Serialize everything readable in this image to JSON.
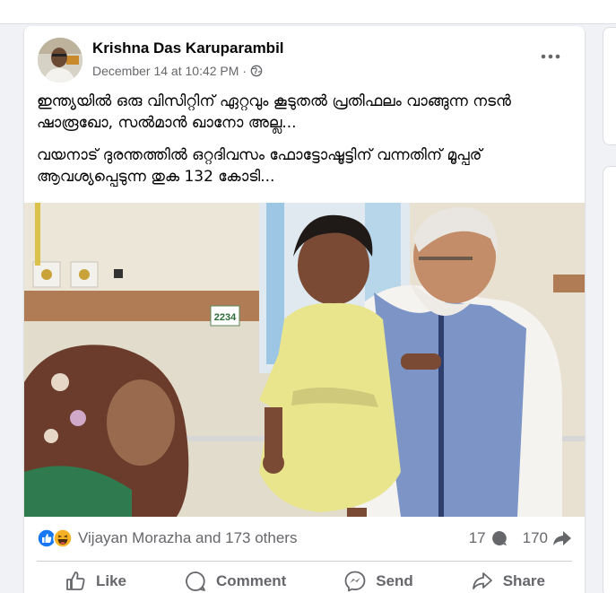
{
  "post": {
    "author": "Krishna Das Karuparambil",
    "timestamp": "December 14 at 10:42 PM",
    "separator": "·",
    "privacy_icon": "globe-icon",
    "more_icon": "more-options-icon",
    "text": {
      "line1": "ഇന്ത്യയിൽ ഒരു വിസിറ്റിന് ഏറ്റവും കൂടുതൽ പ്രതിഫലം വാങ്ങുന്ന നടൻ ഷാരൂഖോ, സൽമാൻ ഖാനോ അല്ല...",
      "line2": "വയനാട് ദുരന്തത്തിൽ ഒറ്റദിവസം ഫോട്ടോഷൂട്ടിന് വന്നതിന്  മൂപ്പര് ആവശ്യപ്പെടുന്ന തുക 132 കോടി..."
    },
    "photo": {
      "room_number": "2234"
    },
    "reactions": {
      "icons": [
        "like-reaction-icon",
        "haha-reaction-icon"
      ],
      "summary": "Vijayan Morazha and 173 others"
    },
    "comments_count": "17",
    "shares_count": "170",
    "actions": {
      "like": "Like",
      "comment": "Comment",
      "send": "Send",
      "share": "Share"
    }
  },
  "colors": {
    "background": "#f0f2f5",
    "card": "#ffffff",
    "secondary_text": "#65676b",
    "like_blue": "#1877f2",
    "haha_yellow": "#f7b125"
  }
}
